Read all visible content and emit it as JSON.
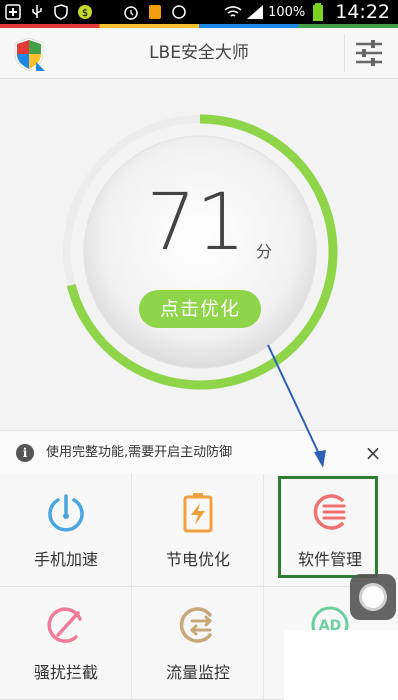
{
  "status_bar": {
    "battery_percent": "100%",
    "time": "14:22",
    "icons": [
      "add-icon",
      "usb-icon",
      "shield-icon",
      "dollar-icon",
      "alarm-icon",
      "notification-icon",
      "sync-icon",
      "wifi-icon",
      "signal-icon",
      "battery-icon"
    ]
  },
  "header": {
    "title": "LBE安全大师",
    "logo_icon": "shield-logo-icon",
    "settings_icon": "sliders-icon"
  },
  "score": {
    "value": "71",
    "unit": "分",
    "level": 0.71,
    "button_label": "点击优化",
    "accent_color": "#8fd54a"
  },
  "notice": {
    "text": "使用完整功能,需要开启主动防御",
    "close": "×"
  },
  "features": [
    {
      "label": "手机加速",
      "icon": "power-icon",
      "color": "#4aa6e0"
    },
    {
      "label": "节电优化",
      "icon": "battery-bolt-icon",
      "color": "#f0a03c"
    },
    {
      "label": "软件管理",
      "icon": "app-manage-icon",
      "color": "#f07070"
    },
    {
      "label": "骚扰拦截",
      "icon": "block-icon",
      "color": "#f07a9a"
    },
    {
      "label": "流量监控",
      "icon": "data-traffic-icon",
      "color": "#c8a878"
    },
    {
      "label": "",
      "icon": "ad-icon",
      "color": "#6ccfa0"
    }
  ],
  "annotation": {
    "highlight_color": "#2e7d32",
    "arrow_color": "#2e5fb8"
  }
}
